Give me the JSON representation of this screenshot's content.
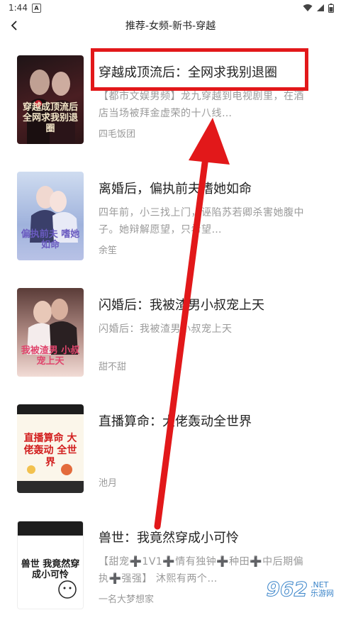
{
  "status": {
    "time": "1:44",
    "badge": "A"
  },
  "header": {
    "title": "推荐-女频-新书-穿越"
  },
  "books": [
    {
      "title": "穿越成顶流后：全网求我别退圈",
      "desc": "【都市文娱男频】龙九穿越到电视剧里，在酒店当场被拜金虚荣的十八线…",
      "author": "四毛饭团",
      "cover_text": "穿越成顶流后 全网求我别退圈",
      "cover_colors": [
        "#2a1a1c",
        "#6b2a30"
      ],
      "cover_text_color": "#f3e6c8"
    },
    {
      "title": "离婚后，偏执前夫嗜她如命",
      "desc": "四年前，小三找上门，诬陷苏若卿杀害她腹中子。她辩解愿望，只希望…",
      "author": "余笙",
      "cover_text": "偏执前夫 嗜她如命",
      "cover_colors": [
        "#c9d6ec",
        "#8fa4d2"
      ],
      "cover_text_color": "#6a5bc0"
    },
    {
      "title": "闪婚后：我被渣男小叔宠上天",
      "desc": "闪婚后：我被渣男小叔宠上天",
      "author": "甜不甜",
      "cover_text": "我被渣男 小叔宠上天",
      "cover_colors": [
        "#6b4a46",
        "#e9c9c4"
      ],
      "cover_text_color": "#e0466d"
    },
    {
      "title": "直播算命：大佬轰动全世界",
      "desc": "",
      "author": "池月",
      "cover_text": "直播算命 大佬轰动 全世界",
      "cover_colors": [
        "#fbf6ea",
        "#f3efe4"
      ],
      "cover_text_color": "#d21f1f"
    },
    {
      "title": "兽世：我竟然穿成小可怜",
      "desc": "【甜宠➕1V1➕情有独钟➕种田➕中后期偏执➕强强】 沐熙有两个…",
      "author": "一名大梦想家",
      "cover_text": "兽世 我竟然穿 成小可怜",
      "cover_colors": [
        "#ffffff",
        "#f1f1f1"
      ],
      "cover_text_color": "#1d1d1d"
    }
  ],
  "watermark": {
    "number": "962",
    "domain": ".NET",
    "site": "乐游网"
  },
  "annotation": {
    "color": "#e2181a"
  }
}
